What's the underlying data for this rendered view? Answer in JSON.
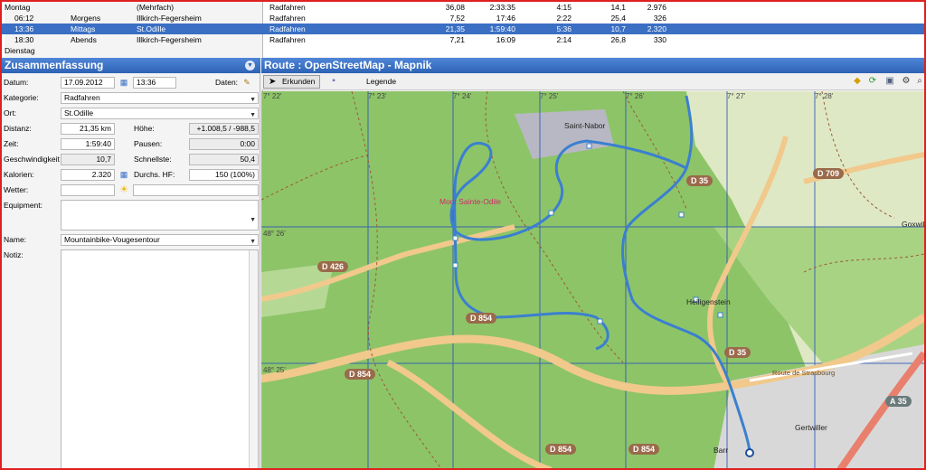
{
  "activities": {
    "rows": [
      {
        "time": "",
        "daypart": "Montag",
        "place": "(Mehrfach)",
        "sport": "Radfahren",
        "distance": "36,08",
        "duration": "2:33:35",
        "pace": "4:15",
        "speed": "14,1",
        "elevation": "2.976",
        "first_col_is_day": true
      },
      {
        "time": "06:12",
        "daypart": "Morgens",
        "place": "Illkirch-Fegersheim",
        "sport": "Radfahren",
        "distance": "7,52",
        "duration": "17:46",
        "pace": "2:22",
        "speed": "25,4",
        "elevation": "326"
      },
      {
        "time": "13:36",
        "daypart": "Mittags",
        "place": "St.Odille",
        "sport": "Radfahren",
        "distance": "21,35",
        "duration": "1:59:40",
        "pace": "5:36",
        "speed": "10,7",
        "elevation": "2.320",
        "selected": true
      },
      {
        "time": "18:30",
        "daypart": "Abends",
        "place": "Illkirch-Fegersheim",
        "sport": "Radfahren",
        "distance": "7,21",
        "duration": "16:09",
        "pace": "2:14",
        "speed": "26,8",
        "elevation": "330"
      }
    ],
    "next_day": "Dienstag"
  },
  "summary": {
    "title": "Zusammenfassung",
    "date_label": "Datum:",
    "date": "17.09.2012",
    "time": "13:36",
    "data_label": "Daten:",
    "category_label": "Kategorie:",
    "category": "Radfahren",
    "place_label": "Ort:",
    "place": "St.Odille",
    "distance_label": "Distanz:",
    "distance": "21,35 km",
    "elevation_label": "Höhe:",
    "elevation": "+1.008,5 / -988,5",
    "time_label": "Zeit:",
    "duration": "1:59:40",
    "pause_label": "Pausen:",
    "pause": "0:00",
    "speed_label": "Geschwindigkeit",
    "speed": "10,7",
    "fastest_label": "Schnellste:",
    "fastest": "50,4",
    "calories_label": "Kalorien:",
    "calories": "2.320",
    "hr_label": "Durchs. HF:",
    "hr": "150 (100%)",
    "weather_label": "Wetter:",
    "weather": "",
    "equipment_label": "Equipment:",
    "name_label": "Name:",
    "name": "Mountainbike-Vougesentour",
    "note_label": "Notiz:"
  },
  "map": {
    "title": "Route : OpenStreetMap - Mapnik",
    "explore": "Erkunden",
    "legend": "Legende",
    "lon_labels": [
      "7° 22'",
      "7° 23'",
      "7° 24'",
      "7° 25'",
      "7° 26'",
      "7° 27'",
      "7° 28'"
    ],
    "lat_labels": [
      "48° 27'",
      "48° 26'",
      "48° 25'"
    ],
    "places": [
      "Saint-Nabor",
      "Mont Sainte-Odile",
      "Heiligenstein",
      "Gertwiller",
      "Barr",
      "Goxwill"
    ],
    "roads": [
      "D 426",
      "D 854",
      "D 854",
      "D 854",
      "D 854",
      "D 709",
      "D 35",
      "D 35",
      "A 35",
      "Route de Strasbourg"
    ],
    "colors": {
      "forest": "#8dc468",
      "route": "#3b7fd0",
      "header": "#2e62b4",
      "selected": "#3a6fc4"
    }
  }
}
